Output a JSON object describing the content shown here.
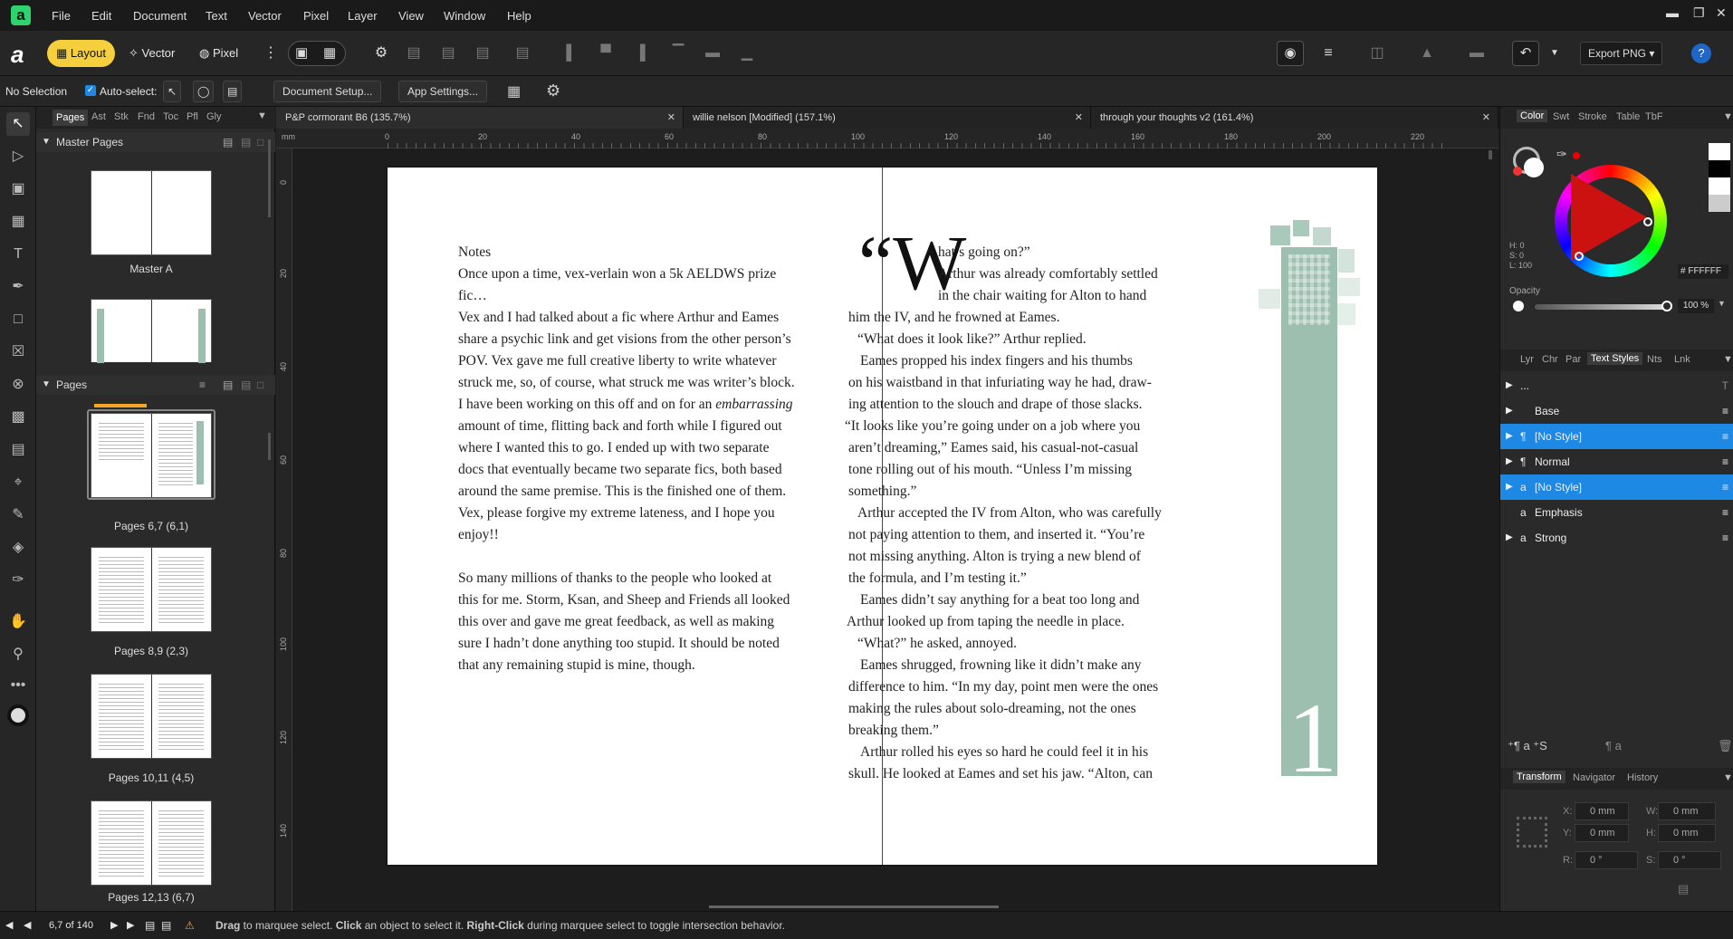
{
  "menu": [
    "File",
    "Edit",
    "Document",
    "Text",
    "Vector",
    "Pixel",
    "Layer",
    "View",
    "Window",
    "Help"
  ],
  "personas": {
    "layout": "Layout",
    "vector": "Vector",
    "pixel": "Pixel"
  },
  "toolbar": {
    "export_label": "Export PNG"
  },
  "context": {
    "selection": "No Selection",
    "auto_select": "Auto-select:",
    "doc_setup": "Document Setup...",
    "app_settings": "App Settings..."
  },
  "left_panel": {
    "tabs": [
      "Pages",
      "Ast",
      "Stk",
      "Fnd",
      "Toc",
      "Pfl",
      "Gly"
    ],
    "master_header": "Master Pages",
    "master_label": "Master A",
    "pages_header": "Pages",
    "pages": [
      "Pages 6,7 (6,1)",
      "Pages 8,9 (2,3)",
      "Pages 10,11 (4,5)",
      "Pages 12,13 (6,7)"
    ]
  },
  "doc_tabs": [
    "P&P cormorant B6 (135.7%)",
    "willie nelson [Modified] (157.1%)",
    "through your thoughts v2 (161.4%)"
  ],
  "ruler_unit": "mm",
  "ruler_h": [
    "0",
    "20",
    "40",
    "60",
    "80",
    "100",
    "120",
    "140",
    "160",
    "180",
    "200",
    "220"
  ],
  "ruler_v": [
    "0",
    "20",
    "40",
    "60",
    "80",
    "100",
    "120",
    "140"
  ],
  "left_page_lines": [
    "Notes",
    "Once upon a time, vex-verlain won a 5k AELDWS prize",
    "fic…",
    "Vex and I had talked about a fic where Arthur and Eames",
    "share a psychic link and get visions from the other person’s",
    "POV. Vex gave me full creative liberty to write whatever",
    "struck me, so, of course, what struck me was writer’s block.",
    "I have been working on this off and on for an ",
    "amount of time, flitting back and forth while I figured out",
    "where I wanted this to go. I ended up with two separate",
    "docs that eventually became two separate fics, both based",
    "around the same premise. This is the finished one of them.",
    "Vex, please forgive my extreme lateness, and I hope you",
    "enjoy!!",
    "",
    "So many millions of thanks to the people who looked at",
    "this for me. Storm, Ksan, and Sheep and Friends all looked",
    "this over and gave me great feedback, as well as making",
    "sure I hadn’t done anything too stupid. It should be noted",
    "that any remaining stupid is mine, though."
  ],
  "left_italic": "embarrassing",
  "dropcap": "“W",
  "right_page_lines": [
    "hat’s going on?”",
    "Arthur was already comfortably settled",
    "in the chair waiting for Alton to hand",
    "him the IV, and he frowned at Eames.",
    "“What does it look like?” Arthur replied.",
    "Eames propped his index fingers and his thumbs",
    "on his waistband in that infuriating way he had, draw-",
    "ing attention to the slouch and drape of those slacks.",
    "“It looks like you’re going under on a job where you",
    "aren’t dreaming,” Eames said, his casual-not-casual",
    "tone rolling out of his mouth. “Unless I’m missing",
    "something.”",
    "Arthur accepted the IV from Alton, who was carefully",
    "not paying attention to them, and inserted it. “You’re",
    "not missing anything. Alton is trying a new blend of",
    "the formula, and I’m testing it.”",
    "Eames didn’t say anything for a beat too long and",
    "Arthur looked up from taping the needle in place.",
    "“What?” he asked, annoyed.",
    "Eames shrugged, frowning like it didn’t make any",
    "difference to him. “In my day, point men were the ones",
    "making the rules about solo-dreaming, not the ones",
    "breaking them.”",
    "Arthur rolled his eyes so hard he could feel it in his",
    "skull. He looked at Eames and set his jaw. “Alton, can"
  ],
  "chapter_number": "1",
  "right_panel": {
    "color_tabs": [
      "Color",
      "Swt",
      "Stroke",
      "Table",
      "TbF"
    ],
    "hsl": {
      "h": "H: 0",
      "s": "S: 0",
      "l": "L: 100"
    },
    "hex": "# FFFFFF",
    "opacity_label": "Opacity",
    "opacity_value": "100 %",
    "style_tabs": [
      "Lyr",
      "Chr",
      "Par",
      "Text Styles",
      "Nts",
      "Lnk"
    ],
    "styles": [
      {
        "name": "...",
        "icon": ""
      },
      {
        "name": "Base",
        "icon": ""
      },
      {
        "name": "[No Style]",
        "icon": "¶"
      },
      {
        "name": "Normal",
        "icon": "¶"
      },
      {
        "name": "[No Style]",
        "icon": "a"
      },
      {
        "name": "Emphasis",
        "icon": "a"
      },
      {
        "name": "Strong",
        "icon": "a"
      }
    ],
    "bottom_tabs": [
      "Transform",
      "Navigator",
      "History"
    ],
    "transform": {
      "x": "0 mm",
      "y": "0 mm",
      "w": "0 mm",
      "h": "0 mm",
      "r": "0 °",
      "s": "0 °"
    }
  },
  "status": {
    "page": "6,7 of 140",
    "drag": "Drag",
    "drag_text": " to marquee select. ",
    "click": "Click",
    "click_text": " an object to select it. ",
    "rclick": "Right-Click",
    "rclick_text": " during marquee select to toggle intersection behavior."
  },
  "colors": {
    "accent": "#f5d03c",
    "highlight": "#1e88e5",
    "chapter_green": "#9dbfb0"
  }
}
